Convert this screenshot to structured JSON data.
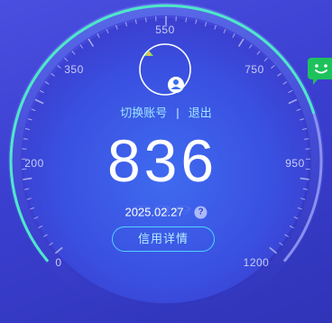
{
  "gauge": {
    "tick_labels": [
      "0",
      "200",
      "350",
      "550",
      "750",
      "950",
      "1200"
    ],
    "colors": {
      "track": "#8a90f0",
      "progress": "#4de8c8",
      "accent": "#4fd3ff"
    }
  },
  "account": {
    "switch_label": "切换账号",
    "separator": "|",
    "logout_label": "退出"
  },
  "score": {
    "value": "836",
    "date": "2025.02.27",
    "help_label": "?"
  },
  "detail_button": {
    "label": "信用详情"
  },
  "avatar": {
    "icon": "user-avatar-icon"
  },
  "chat": {
    "icon": "chat-face-icon",
    "color": "#1ec25c"
  }
}
